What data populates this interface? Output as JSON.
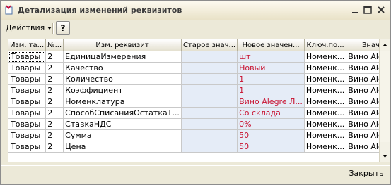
{
  "window": {
    "title": "Детализация изменений реквизитов"
  },
  "toolbar": {
    "actions_label": "Действия",
    "help_label": "?"
  },
  "table": {
    "columns": [
      "Изм. та...",
      "№...",
      "Изм. реквизит",
      "Старое знач...",
      "Новое значен...",
      "Ключ.по...",
      "Значение"
    ],
    "rows": [
      [
        "Товары",
        "2",
        "ЕдиницаИзмерения",
        "",
        "шт",
        "Номенк...",
        "Вино Alegre Л..."
      ],
      [
        "Товары",
        "2",
        "Качество",
        "",
        "Новый",
        "Номенк...",
        "Вино Alegre Л..."
      ],
      [
        "Товары",
        "2",
        "Количество",
        "",
        "1",
        "Номенк...",
        "Вино Alegre Л..."
      ],
      [
        "Товары",
        "2",
        "Коэффициент",
        "",
        "1",
        "Номенк...",
        "Вино Alegre Л..."
      ],
      [
        "Товары",
        "2",
        "Номенклатура",
        "",
        "Вино Alegre Л...",
        "Номенк...",
        "Вино Alegre Л..."
      ],
      [
        "Товары",
        "2",
        "СпособСписанияОстаткаТ...",
        "",
        "Со склада",
        "Номенк...",
        "Вино Alegre Л..."
      ],
      [
        "Товары",
        "2",
        "СтавкаНДС",
        "",
        "0%",
        "Номенк...",
        "Вино Alegre Л..."
      ],
      [
        "Товары",
        "2",
        "Сумма",
        "",
        "50",
        "Номенк...",
        "Вино Alegre Л..."
      ],
      [
        "Товары",
        "2",
        "Цена",
        "",
        "50",
        "Номенк...",
        "Вино Alegre Л..."
      ]
    ]
  },
  "footer": {
    "close_label": "Закрыть"
  },
  "colors": {
    "new_value": "#c8102e",
    "value_column_bg": "#e5ecf7",
    "window_bg": "#ece9d8"
  },
  "icons": [
    "app-icon",
    "minimize-icon",
    "maximize-icon",
    "close-icon",
    "scroll-up-icon",
    "scroll-down-icon"
  ]
}
